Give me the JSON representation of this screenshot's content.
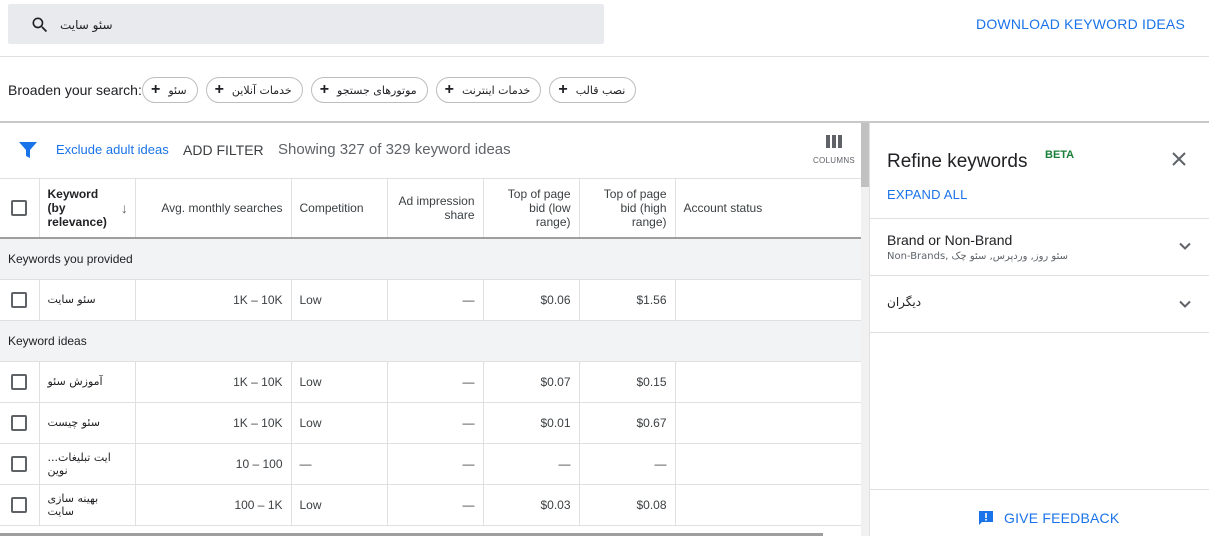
{
  "search": {
    "query": "سئو سایت"
  },
  "header": {
    "download_label": "DOWNLOAD KEYWORD IDEAS"
  },
  "broaden": {
    "label": "Broaden your search:",
    "chips": [
      "سئو",
      "خدمات آنلاین",
      "موتورهای جستجو",
      "خدمات اینترنت",
      "نصب قالب"
    ]
  },
  "toolbar": {
    "exclude_label": "Exclude adult ideas",
    "add_filter_label": "ADD FILTER",
    "showing_text": "Showing 327 of 329 keyword ideas",
    "columns_label": "COLUMNS"
  },
  "table": {
    "headers": {
      "keyword": "Keyword (by relevance)",
      "searches": "Avg. monthly searches",
      "competition": "Competition",
      "impression": "Ad impression share",
      "bid_low": "Top of page bid (low range)",
      "bid_high": "Top of page bid (high range)",
      "account": "Account status"
    },
    "section_provided": "Keywords you provided",
    "section_ideas": "Keyword ideas",
    "provided_rows": [
      {
        "keyword": "سئو سایت",
        "searches": "1K – 10K",
        "competition": "Low",
        "impression": "—",
        "bid_low": "$0.06",
        "bid_high": "$1.56",
        "account": ""
      }
    ],
    "idea_rows": [
      {
        "keyword": "آموزش سئو",
        "searches": "1K – 10K",
        "competition": "Low",
        "impression": "—",
        "bid_low": "$0.07",
        "bid_high": "$0.15",
        "account": ""
      },
      {
        "keyword": "سئو چیست",
        "searches": "1K – 10K",
        "competition": "Low",
        "impression": "—",
        "bid_low": "$0.01",
        "bid_high": "$0.67",
        "account": ""
      },
      {
        "keyword": "...ایت تبلیغات نوین",
        "searches": "10 – 100",
        "competition": "—",
        "impression": "—",
        "bid_low": "—",
        "bid_high": "—",
        "account": ""
      },
      {
        "keyword": "بهینه سازی سایت",
        "searches": "100 – 1K",
        "competition": "Low",
        "impression": "—",
        "bid_low": "$0.03",
        "bid_high": "$0.08",
        "account": ""
      }
    ]
  },
  "refine": {
    "title": "Refine keywords",
    "beta": "BETA",
    "expand_all": "EXPAND ALL",
    "groups": [
      {
        "title": "Brand or Non-Brand",
        "subtitle": "Non-Brands, سئو روز, وردپرس, سئو چک"
      },
      {
        "title": "دیگران",
        "subtitle": ""
      }
    ],
    "feedback_label": "GIVE FEEDBACK"
  },
  "colors": {
    "accent": "#1a73e8",
    "beta": "#188038"
  }
}
